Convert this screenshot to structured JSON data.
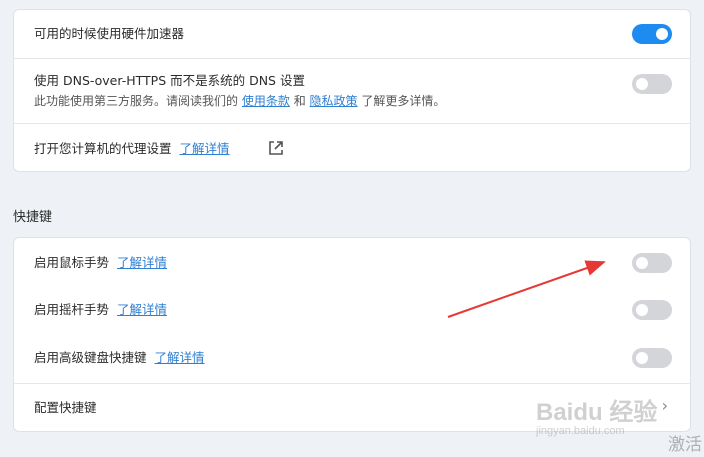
{
  "network": {
    "hw_accel_label": "可用的时候使用硬件加速器",
    "dns_label": "使用 DNS-over-HTTPS 而不是系统的 DNS 设置",
    "dns_desc_prefix": "此功能使用第三方服务。请阅读我们的",
    "dns_terms_link": "使用条款",
    "dns_and": "和",
    "dns_privacy_link": "隐私政策",
    "dns_desc_suffix": "了解更多详情。",
    "proxy_label": "打开您计算机的代理设置",
    "proxy_link": "了解详情"
  },
  "shortcuts": {
    "title": "快捷键",
    "mouse_gesture_label": "启用鼠标手势",
    "mouse_gesture_link": "了解详情",
    "rocker_gesture_label": "启用摇杆手势",
    "rocker_gesture_link": "了解详情",
    "advanced_keyboard_label": "启用高级键盘快捷键",
    "advanced_keyboard_link": "了解详情",
    "configure_label": "配置快捷键"
  },
  "toggles": {
    "hw_accel": true,
    "dns_over_https": false,
    "mouse_gesture": false,
    "rocker_gesture": false,
    "advanced_keyboard": false
  },
  "watermark": {
    "brand": "Baidu 经验",
    "url": "jingyan.baidu.com",
    "activate": "激活"
  },
  "colors": {
    "accent": "#1e8bf0",
    "link": "#2f7fd1",
    "arrow": "#e53935"
  }
}
